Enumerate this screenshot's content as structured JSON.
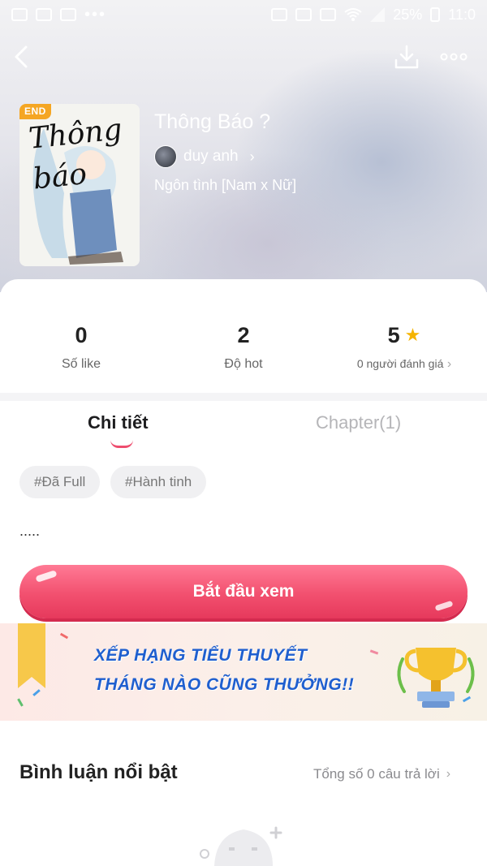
{
  "status_bar": {
    "battery": "25%",
    "time": "11:0",
    "dots": "•••"
  },
  "header": {
    "back_icon": "chevron-left-icon",
    "download_icon": "download-icon",
    "more_icon": "more-dots-icon"
  },
  "book": {
    "badge": "END",
    "cover_text": "Thông báo",
    "title": "Thông Báo ?",
    "author": "duy anh",
    "genre": "Ngôn tình [Nam x Nữ]"
  },
  "stats": {
    "likes_value": "0",
    "likes_label": "Số like",
    "hot_value": "2",
    "hot_label": "Độ hot",
    "rating_value": "5",
    "rating_label": "0 người đánh giá"
  },
  "tabs": {
    "detail": "Chi tiết",
    "chapter": "Chapter(1)"
  },
  "tags": [
    "#Đã Full",
    "#Hành tinh"
  ],
  "synopsis": ".....",
  "start_button": "Bắt đầu xem",
  "banner": {
    "line1": "XẾP HẠNG TIỂU THUYẾT",
    "line2": "THÁNG NÀO CŨNG THƯỞNG!!"
  },
  "comments": {
    "title": "Bình luận nổi bật",
    "count_text": "Tổng số 0 câu trả lời"
  },
  "colors": {
    "accent": "#ee4d6e",
    "star": "#f5b400",
    "banner_text": "#1f5fcf"
  }
}
